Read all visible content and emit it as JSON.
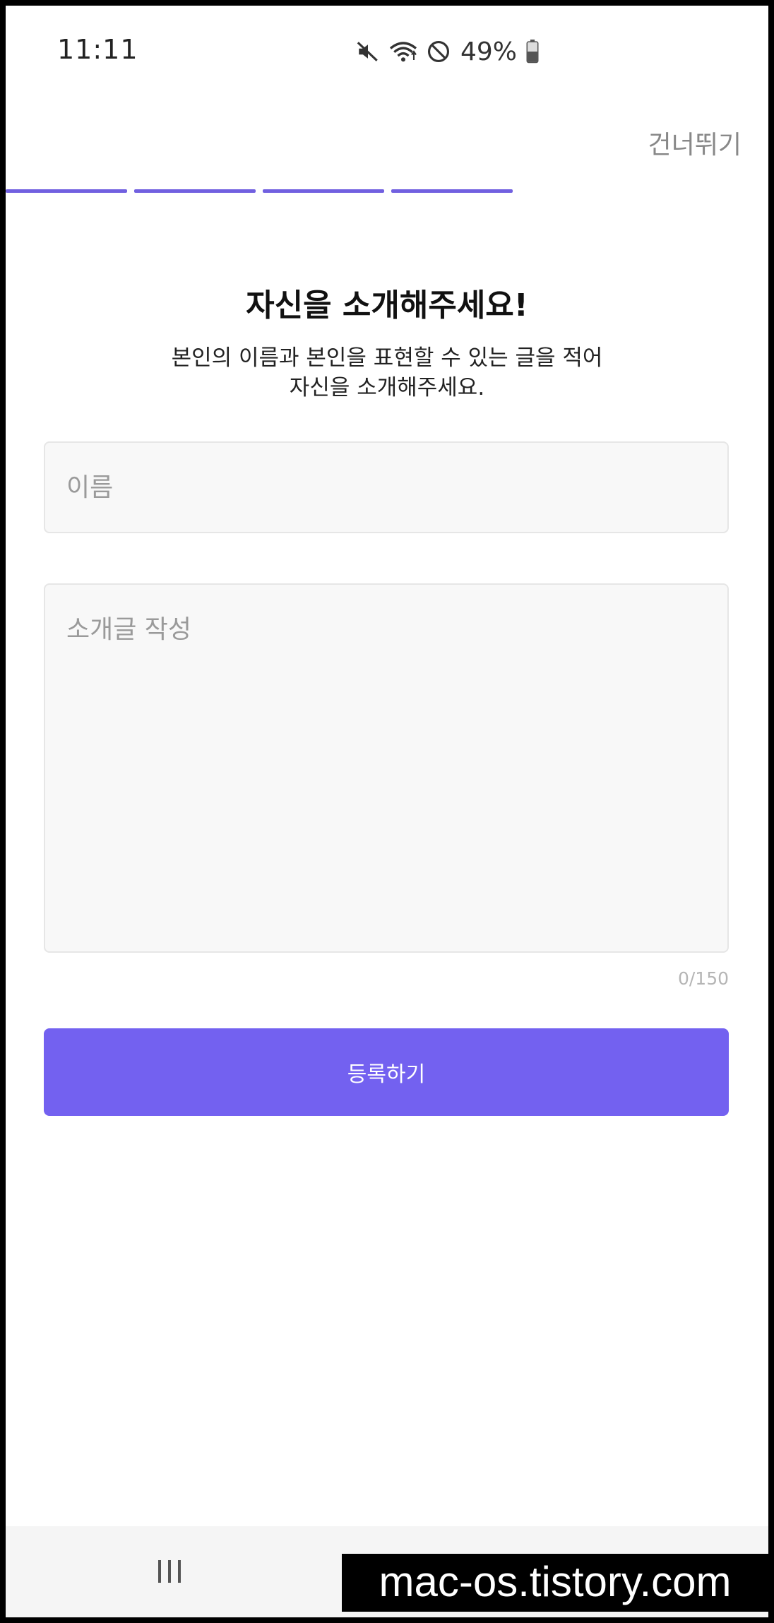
{
  "status_bar": {
    "time": "11:11",
    "battery": "49%",
    "icons": [
      "mute-icon",
      "wifi-icon",
      "do-not-disturb-icon",
      "battery-icon"
    ]
  },
  "header": {
    "skip_label": "건너뛰기",
    "progress_segments": 4,
    "accent_color": "#7160e0"
  },
  "main": {
    "title": "자신을 소개해주세요!",
    "subtitle_line1": "본인의 이름과 본인을 표현할 수 있는 글을 적어",
    "subtitle_line2": "자신을 소개해주세요.",
    "name_field": {
      "value": "",
      "placeholder": "이름"
    },
    "intro_field": {
      "value": "",
      "placeholder": "소개글 작성"
    },
    "char_count": "0/150",
    "submit_label": "등록하기",
    "button_color": "#7361f0"
  },
  "nav_bar": {
    "icons": [
      "recent-apps-icon",
      "home-icon",
      "back-icon"
    ]
  },
  "watermark": {
    "text": "mac-os.tistory.com"
  }
}
